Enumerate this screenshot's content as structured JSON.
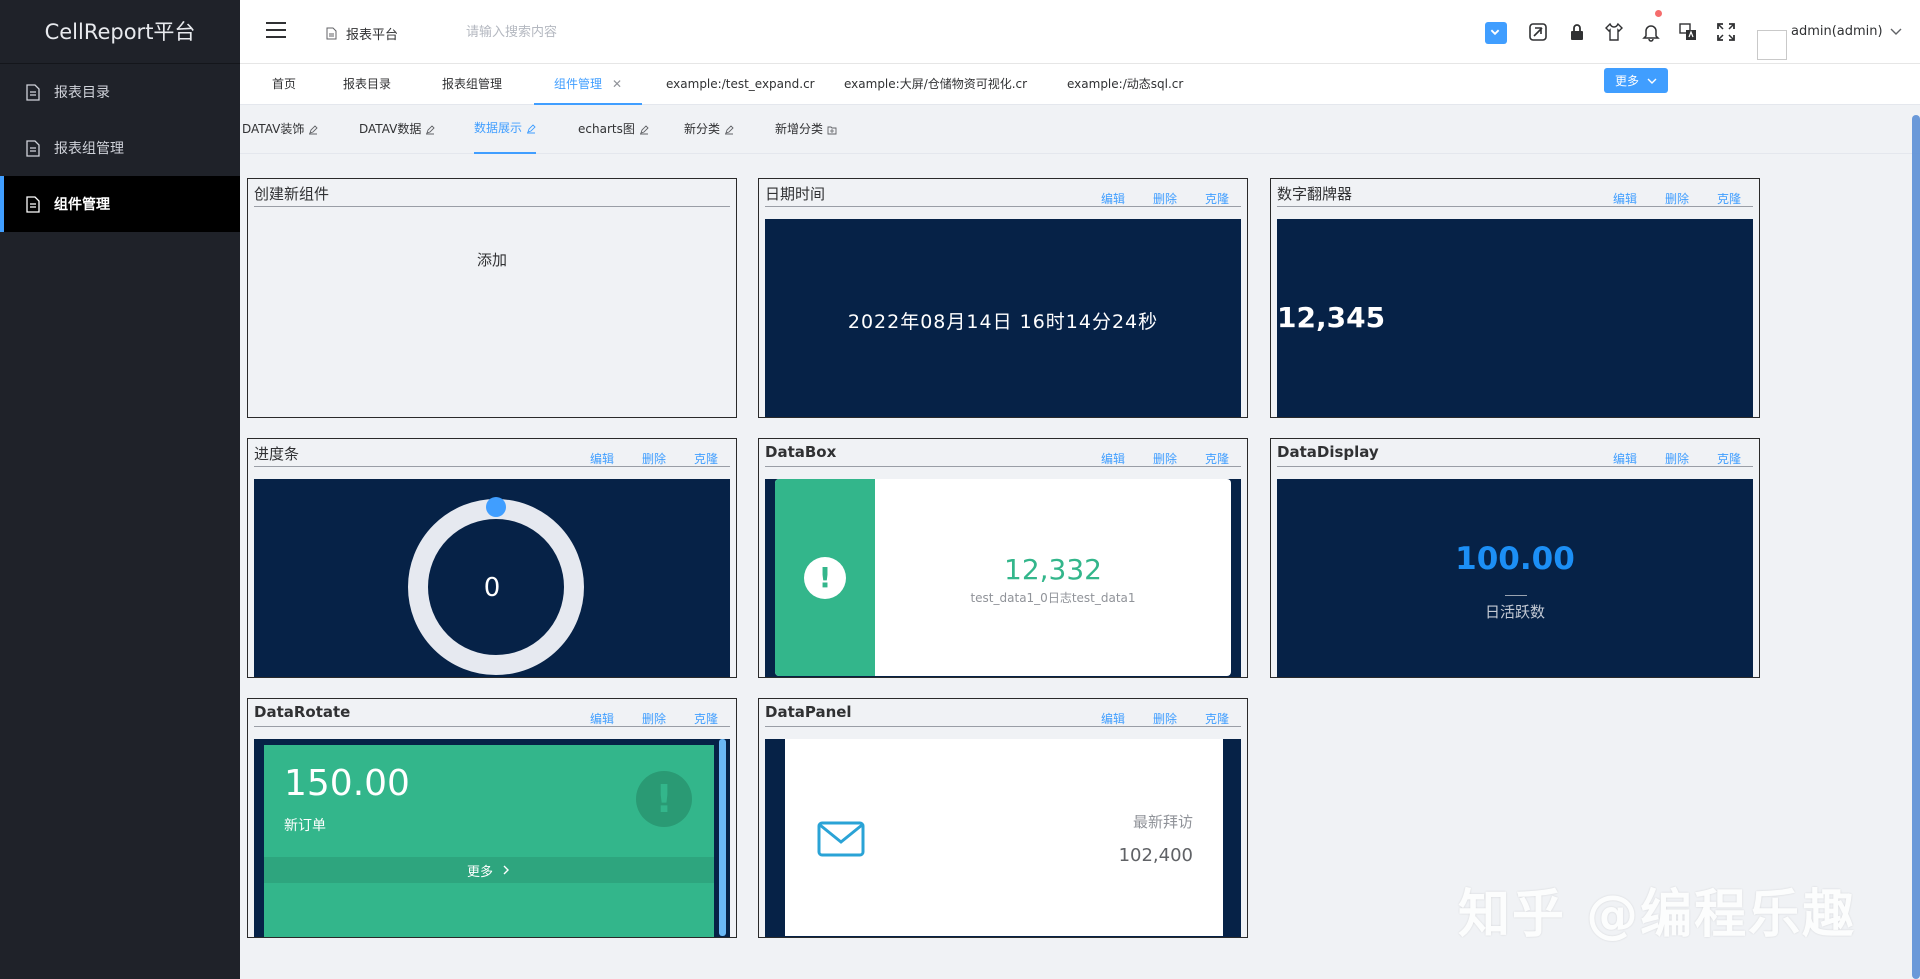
{
  "app": {
    "title": "CellReport平台"
  },
  "sidebar": {
    "items": [
      {
        "label": "报表目录",
        "active": false
      },
      {
        "label": "报表组管理",
        "active": false
      },
      {
        "label": "组件管理",
        "active": true
      }
    ]
  },
  "header": {
    "breadcrumb": "报表平台",
    "search_placeholder": "请输入搜索内容",
    "icons": [
      "checkbox-icon",
      "theme-icon",
      "lock-icon",
      "shirt-icon",
      "bell-icon",
      "translate-icon",
      "fullscreen-icon"
    ],
    "username": "admin(admin)"
  },
  "tabs": {
    "items": [
      {
        "label": "首页"
      },
      {
        "label": "报表目录"
      },
      {
        "label": "报表组管理"
      },
      {
        "label": "组件管理",
        "active": true,
        "closable": true
      },
      {
        "label": "example:/test_expand.cr"
      },
      {
        "label": "example:大屏/仓储物资可视化.cr"
      },
      {
        "label": "example:/动态sql.cr"
      }
    ],
    "more_label": "更多"
  },
  "categories": {
    "items": [
      {
        "label": "DATAV装饰"
      },
      {
        "label": "DATAV数据"
      },
      {
        "label": "数据展示",
        "active": true
      },
      {
        "label": "echarts图"
      },
      {
        "label": "新分类"
      },
      {
        "label": "新增分类"
      }
    ]
  },
  "card_actions": {
    "edit": "编辑",
    "delete": "删除",
    "clone": "克隆"
  },
  "cards": {
    "create": {
      "title": "创建新组件",
      "add_label": "添加"
    },
    "datetime": {
      "title": "日期时间",
      "value": "2022年08月14日 16时14分24秒"
    },
    "flipper": {
      "title": "数字翻牌器",
      "value": "12,345"
    },
    "progress": {
      "title": "进度条",
      "value": "0",
      "percent": 0
    },
    "databox": {
      "title": "DataBox",
      "value": "12,332",
      "subtitle": "test_data1_0日志test_data1",
      "icon": "exclamation-icon"
    },
    "datadisplay": {
      "title": "DataDisplay",
      "value": "100.00",
      "label": "日活跃数"
    },
    "datarotate": {
      "title": "DataRotate",
      "value": "150.00",
      "label": "新订单",
      "more": "更多",
      "icon": "exclamation-icon"
    },
    "datapanel": {
      "title": "DataPanel",
      "label": "最新拜访",
      "value": "102,400",
      "icon": "mail-icon"
    }
  },
  "watermark": "知乎 @编程乐趣",
  "colors": {
    "sidebar_bg": "#1f2229",
    "accent": "#409eff",
    "card_dark": "#062247",
    "green": "#33b68b"
  }
}
